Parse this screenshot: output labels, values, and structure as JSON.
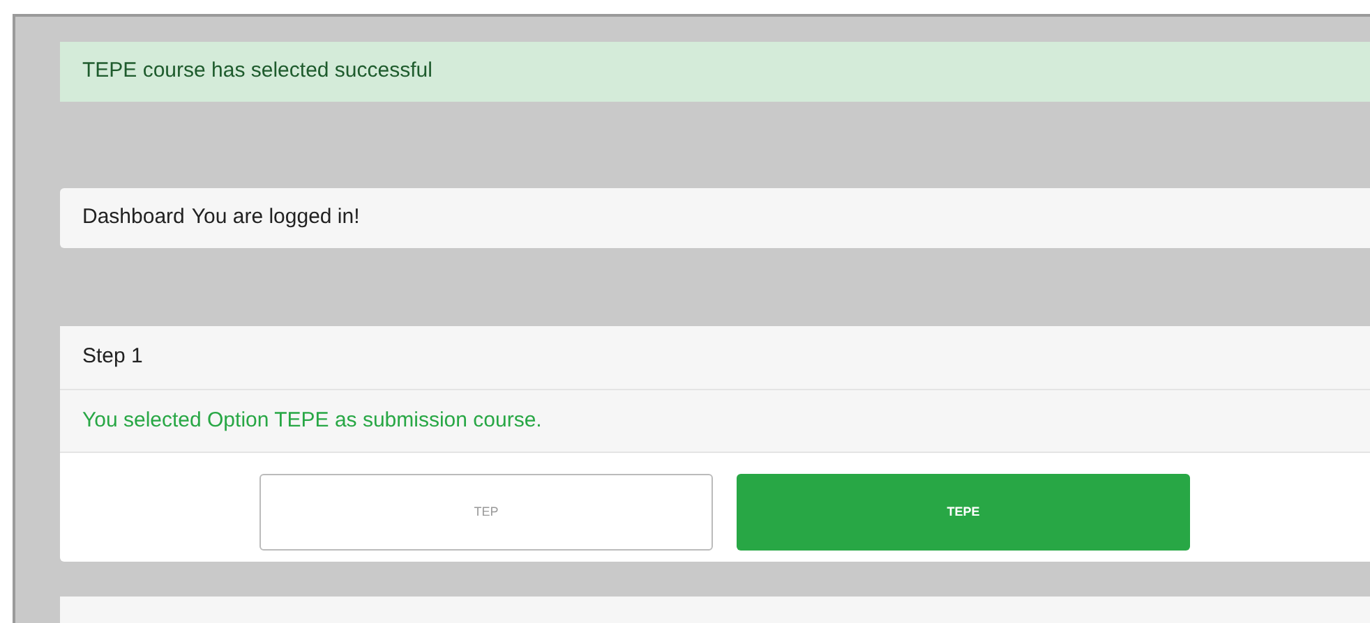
{
  "alert": {
    "text": "TEPE course has selected successful"
  },
  "dashboard": {
    "title": "Dashboard",
    "message": "You are logged in!"
  },
  "step": {
    "title": "Step 1",
    "message": "You selected Option TEPE as submission course.",
    "options": [
      {
        "label": "TEP",
        "selected": false
      },
      {
        "label": "TEPE",
        "selected": true
      }
    ]
  }
}
